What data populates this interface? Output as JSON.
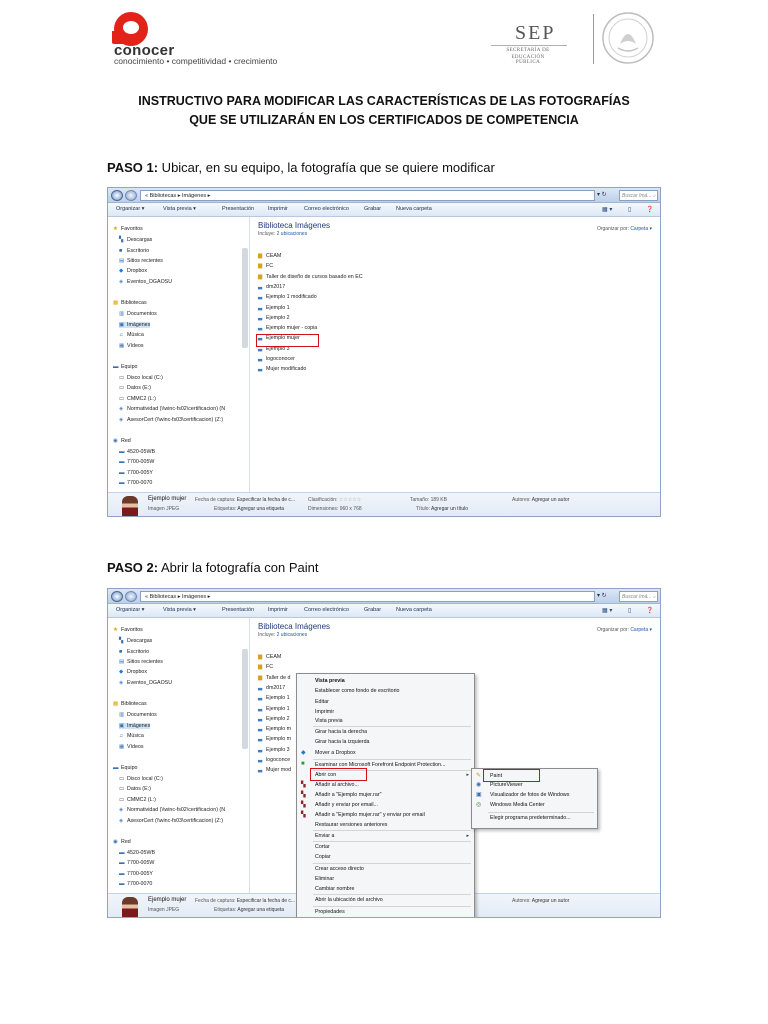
{
  "header": {
    "logo_name": "conocer",
    "logo_tagline": "conocimiento • competitividad • crecimiento",
    "sep_name": "SEP",
    "sep_line1": "SECRETARÍA DE",
    "sep_line2": "EDUCACIÓN PÚBLICA"
  },
  "title_line1": "INSTRUCTIVO PARA MODIFICAR LAS CARACTERÍSTICAS DE LAS FOTOGRAFÍAS",
  "title_line2": "QUE SE UTILIZARÁN EN LOS CERTIFICADOS DE COMPETENCIA",
  "step1": {
    "label": "PASO 1:",
    "text": " Ubicar, en su equipo, la fotografía que se quiere modificar"
  },
  "step2": {
    "label": "PASO 2:",
    "text": " Abrir la fotografía con Paint"
  },
  "explorer": {
    "address": "« Bibliotecas ▸ Imágenes ▸",
    "search_placeholder": "Buscar Imá...",
    "toolbar": [
      "Organizar ▾",
      "Vista previa ▾",
      "Presentación",
      "Imprimir",
      "Correo electrónico",
      "Grabar",
      "Nueva carpeta"
    ],
    "nav": [
      {
        "icon": "★",
        "label": "Favoritos",
        "color": "#e0a000"
      },
      {
        "icon": "▚",
        "label": "Descargas",
        "color": "#3a6fb0"
      },
      {
        "icon": "■",
        "label": "Escritorio",
        "color": "#3a6fb0"
      },
      {
        "icon": "▤",
        "label": "Sitios recientes",
        "color": "#3a6fb0"
      },
      {
        "icon": "◆",
        "label": "Dropbox",
        "color": "#1c7cd6"
      },
      {
        "icon": "◈",
        "label": "Eventos_DGAOSU",
        "color": "#5a8ac0"
      },
      {
        "icon": "▩",
        "label": "Bibliotecas",
        "color": "#e0a000"
      },
      {
        "icon": "▥",
        "label": "Documentos",
        "color": "#3a6fb0"
      },
      {
        "icon": "▣",
        "label": "Imágenes",
        "color": "#3a6fb0"
      },
      {
        "icon": "♫",
        "label": "Música",
        "color": "#3a6fb0"
      },
      {
        "icon": "▦",
        "label": "Vídeos",
        "color": "#3a6fb0"
      },
      {
        "icon": "▬",
        "label": "Equipo",
        "color": "#3a6fb0"
      },
      {
        "icon": "▭",
        "label": "Disco local (C:)",
        "color": "#555"
      },
      {
        "icon": "▭",
        "label": "Datos (E:)",
        "color": "#555"
      },
      {
        "icon": "▭",
        "label": "CMMC2 (L:)",
        "color": "#555"
      },
      {
        "icon": "◈",
        "label": "Normatividad (\\\\winc-fs02\\certificacion) (N",
        "color": "#5a8ac0"
      },
      {
        "icon": "◈",
        "label": "AsesorCert (\\\\winc-fs03\\certificacion) (Z:)",
        "color": "#5a8ac0"
      },
      {
        "icon": "◉",
        "label": "Red",
        "color": "#3a6fb0"
      },
      {
        "icon": "▬",
        "label": "4520-05WB",
        "color": "#3a6fb0"
      },
      {
        "icon": "▬",
        "label": "7700-005W",
        "color": "#3a6fb0"
      },
      {
        "icon": "▬",
        "label": "7700-005Y",
        "color": "#3a6fb0"
      },
      {
        "icon": "▬",
        "label": "7700-0070",
        "color": "#3a6fb0"
      }
    ],
    "library_title": "Biblioteca Imágenes",
    "library_includes_label": "Incluye:",
    "library_includes_value": "2 ubicaciones",
    "organize_label": "Organizar por:",
    "organize_value": "Carpeta ▾",
    "files": [
      {
        "icon": "folder",
        "name": "CEAM"
      },
      {
        "icon": "folder",
        "name": "FC"
      },
      {
        "icon": "folder",
        "name": "Taller de diseño de cursos basado en EC"
      },
      {
        "icon": "image",
        "name": "dm2017"
      },
      {
        "icon": "image",
        "name": "Ejemplo 1 modificado"
      },
      {
        "icon": "image",
        "name": "Ejemplo 1"
      },
      {
        "icon": "image",
        "name": "Ejemplo 2"
      },
      {
        "icon": "image",
        "name": "Ejemplo mujer - copia"
      },
      {
        "icon": "image",
        "name": "Ejemplo mujer"
      },
      {
        "icon": "image",
        "name": "Ejemplo 3"
      },
      {
        "icon": "image",
        "name": "logoconocer"
      },
      {
        "icon": "image",
        "name": "Mujer modificado"
      }
    ],
    "files_trunc": [
      "CEAM",
      "FC",
      "Taller de d",
      "dm2017",
      "Ejemplo 1 ",
      "Ejemplo 1",
      "Ejemplo 2",
      "Ejemplo m",
      "Ejemplo m",
      "Ejemplo 3",
      "logoconce",
      "Mujer mod"
    ],
    "details": {
      "filename": "Ejemplo mujer",
      "type": "Imagen JPEG",
      "capture_label": "Fecha de captura:",
      "capture_value": "Especificar la fecha de c...",
      "rating_label": "Clasificación:",
      "rating_value": "☆☆☆☆☆",
      "tags_label": "Etiquetas:",
      "tags_value": "Agregar una etiqueta",
      "dims_label": "Dimensiones:",
      "dims_value": "960 x 768",
      "size_label": "Tamaño:",
      "size_value": "189 KB",
      "title_label": "Título:",
      "title_value": "Agregar un título",
      "authors_label": "Autores:",
      "authors_value": "Agregar un autor"
    }
  },
  "context_menu": {
    "items": [
      {
        "label": "Vista previa",
        "bold": true
      },
      {
        "label": "Establecer como fondo de escritorio"
      },
      {
        "label": "Editar"
      },
      {
        "label": "Imprimir"
      },
      {
        "label": "Vista previa"
      },
      {
        "label": "Girar hacia la derecha"
      },
      {
        "label": "Girar hacia la izquierda"
      },
      {
        "label": "Mover a Dropbox"
      },
      {
        "label": "Examinar con Microsoft Forefront Endpoint Protection..."
      },
      {
        "label": "Abrir con"
      },
      {
        "label": "Añadir al archivo..."
      },
      {
        "label": "Añadir a \"Ejemplo mujer.rar\""
      },
      {
        "label": "Añadir y enviar por email..."
      },
      {
        "label": "Añadir a \"Ejemplo mujer.rar\" y enviar por email"
      },
      {
        "label": "Restaurar versiones anteriores"
      },
      {
        "label": "Enviar a"
      },
      {
        "label": "Cortar"
      },
      {
        "label": "Copiar"
      },
      {
        "label": "Crear acceso directo"
      },
      {
        "label": "Eliminar"
      },
      {
        "label": "Cambiar nombre"
      },
      {
        "label": "Abrir la ubicación del archivo"
      },
      {
        "label": "Propiedades"
      }
    ],
    "submenu": [
      "Paint",
      "PictureViewer",
      "Visualizador de fotos de Windows",
      "Windows Media Center",
      "Elegir programa predeterminado..."
    ]
  }
}
